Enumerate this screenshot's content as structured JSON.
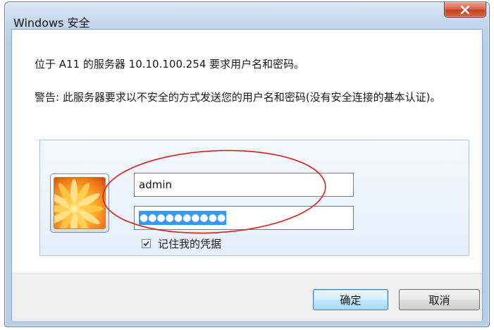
{
  "window": {
    "title": "Windows 安全"
  },
  "message": {
    "line1": "位于 A11 的服务器 10.10.100.254 要求用户名和密码。",
    "warning": "警告: 此服务器要求以不安全的方式发送您的用户名和密码(没有安全连接的基本认证)。"
  },
  "credentials": {
    "username": "admin",
    "password_masked": "●●●●●●●●●●",
    "remember_label": "记住我的凭据",
    "remember_checked": true
  },
  "buttons": {
    "ok": "确定",
    "cancel": "取消"
  },
  "icons": {
    "close": "close-icon",
    "avatar": "user-avatar-flower",
    "checkbox": "checkmark-icon"
  },
  "colors": {
    "annotation": "#d9241c",
    "selection": "#3399ff",
    "close_button": "#c4401f"
  }
}
